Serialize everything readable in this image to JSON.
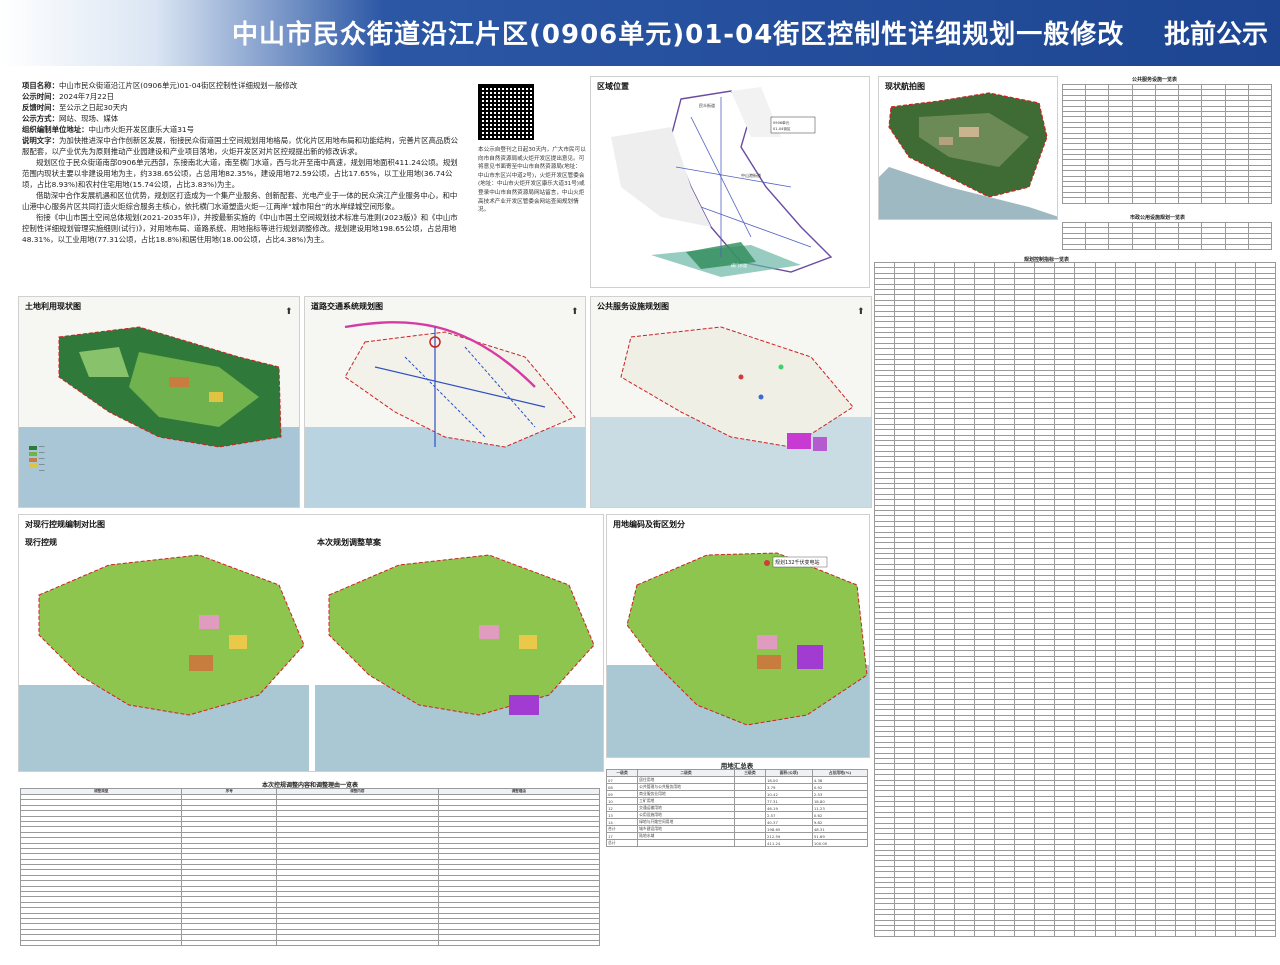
{
  "header": {
    "title": "中山市民众街道沿江片区(0906单元)01-04街区控制性详细规划一般修改",
    "badge": "批前公示"
  },
  "info": {
    "project_label": "项目名称：",
    "project_value": "中山市民众街道沿江片区(0906单元)01-04街区控制性详细规划一般修改",
    "date_label": "公示时间：",
    "date_value": "2024年7月22日",
    "feedback_label": "反馈时间：",
    "feedback_value": "至公示之日起30天内",
    "method_label": "公示方式：",
    "method_value": "网站、现场、媒体",
    "org_label": "组织编制单位地址：",
    "org_value": "中山市火炬开发区康乐大道31号",
    "desc_label": "说明文字：",
    "desc_p1": "为加快推进深中合作创新区发展，衔接民众街道国土空间规划用地格局，优化片区用地布局和功能结构，完善片区高品质公服配套，以产业优先为原则推动产业园建设和产业项目落地，火炬开发区对片区控规提出新的修改诉求。",
    "desc_p2": "规划区位于民众街道南部0906单元西部，东接南北大道，南至横门水道，西与北开至南中高速，规划用地面积411.24公顷。规划范围内现状主要以非建设用地为主，约338.65公顷，占总用地82.35%，建设用地72.59公顷，占比17.65%，以工业用地(36.74公顷，占比8.93%)和农村住宅用地(15.74公顷，占比3.83%)为主。",
    "desc_p3": "借助深中合作发展机遇和区位优势，规划区打造成为一个集产业服务、创新配套、光电产业于一体的民众滨江产业服务中心，和中山港中心服务片区共同打造火炬综合服务主核心，依托横门水道塑造火炬—江两岸“城市阳台”的水岸绿城空间形象。",
    "desc_p4": "衔接《中山市国土空间总体规划(2021-2035年)》，并按最新实施的《中山市国土空间规划技术标准与准则(2023版)》和《中山市控制性详细规划管理实施细则(试行)》，对用地布局、道路系统、用地指标等进行规划调整修改。规划建设用地198.65公顷，占总用地48.31%，以工业用地(77.31公顷，占比18.8%)和居住用地(18.00公顷，占比4.38%)为主。"
  },
  "qr_note": "本公示自登刊之日起30天内，广大市民可以向市自然资源局或火炬开发区提出意见。可将意见书面寄至中山市自然资源局(地址：中山市东区兴中道2号)，火炬开发区管委会(地址：中山市火炬开发区康乐大道31号)或登录中山市自然资源局网站留言，中山火炬高技术产业开发区管委会网站查阅规划情况。",
  "panels": {
    "location": "区域位置",
    "aerial": "现状航拍图",
    "land_use": "土地利用现状图",
    "road": "道路交通系统规划图",
    "public": "公共服务设施规划图",
    "compare": "对现行控规编制对比图",
    "current": "现行控规",
    "adjust": "本次规划调整草案",
    "parcel": "用地编码及街区划分",
    "parcel_tag": "规划132千伏变电站"
  },
  "location_labels": [
    "民众街道",
    "中山港街道",
    "0906单元",
    "01-04街区",
    "横门水道"
  ],
  "tables": {
    "t1": "公共服务设施一览表",
    "t2": "市政公用设施规划一览表",
    "t3": "规划控制指标一览表",
    "bottom": "本次控规调整内容和调整理由一览表",
    "summary": "用地汇总表",
    "summary_sub": "规划用地分类代码"
  },
  "bottom_headers": [
    "调整类型",
    "序号",
    "调整内容",
    "调整理由"
  ],
  "summary_headers": [
    "一级类",
    "二级类",
    "三级类",
    "面积(公顷)",
    "占总用地(%)"
  ],
  "summary_rows": [
    [
      "07",
      "居住用地",
      "18.00",
      "4.38"
    ],
    [
      "08",
      "公共管理与公共服务用地",
      "3.79",
      "0.92"
    ],
    [
      "09",
      "商业服务业用地",
      "10.42",
      "2.53"
    ],
    [
      "10",
      "工矿用地",
      "77.31",
      "18.80"
    ],
    [
      "12",
      "交通运输用地",
      "46.19",
      "11.23"
    ],
    [
      "13",
      "公用设施用地",
      "2.57",
      "0.62"
    ],
    [
      "14",
      "绿地与开敞空间用地",
      "40.37",
      "9.82"
    ],
    [
      "合计",
      "城乡建设用地",
      "198.65",
      "48.31"
    ],
    [
      "17",
      "陆地水域",
      "212.59",
      "51.69"
    ],
    [
      "总计",
      "",
      "411.24",
      "100.00"
    ]
  ]
}
